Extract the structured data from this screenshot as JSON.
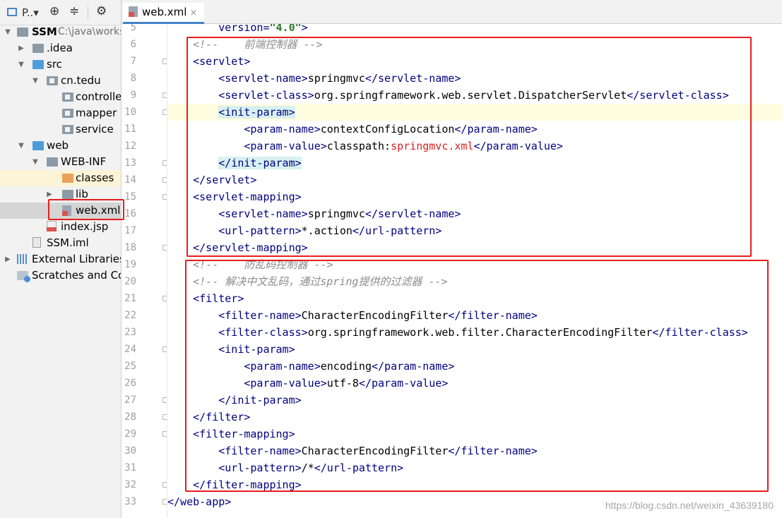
{
  "panel_toolbar": {
    "project_label": "P..▾"
  },
  "tree": [
    {
      "name": "SSM",
      "path": "C:\\java\\works"
    },
    {
      "name": ".idea"
    },
    {
      "name": "src"
    },
    {
      "name": "cn.tedu"
    },
    {
      "name": "controller"
    },
    {
      "name": "mapper"
    },
    {
      "name": "service"
    },
    {
      "name": "web"
    },
    {
      "name": "WEB-INF"
    },
    {
      "name": "classes"
    },
    {
      "name": "lib"
    },
    {
      "name": "web.xml"
    },
    {
      "name": "index.jsp"
    },
    {
      "name": "SSM.iml"
    },
    {
      "name": "External Libraries"
    },
    {
      "name": "Scratches and Cons"
    }
  ],
  "editor": {
    "tab_label": "web.xml",
    "tab_close": "×",
    "line_numbers": [
      "5",
      "6",
      "7",
      "8",
      "9",
      "10",
      "11",
      "12",
      "13",
      "14",
      "15",
      "16",
      "17",
      "18",
      "19",
      "20",
      "21",
      "22",
      "23",
      "24",
      "25",
      "26",
      "27",
      "28",
      "29",
      "30",
      "31",
      "32",
      "33"
    ],
    "lines": [
      [
        {
          "t": "        version=",
          "c": "tag"
        },
        {
          "t": "\"4.0\"",
          "c": "val"
        },
        {
          "t": ">",
          "c": "tag"
        }
      ],
      [
        {
          "t": "    <!--    前端控制器 -->",
          "c": "cmt"
        }
      ],
      [
        {
          "t": "    <",
          "c": "tag"
        },
        {
          "t": "servlet",
          "c": "tag"
        },
        {
          "t": ">",
          "c": "tag"
        }
      ],
      [
        {
          "t": "        <servlet-name>",
          "c": "tag"
        },
        {
          "t": "springmvc"
        },
        {
          "t": "</servlet-name>",
          "c": "tag"
        }
      ],
      [
        {
          "t": "        <servlet-class>",
          "c": "tag"
        },
        {
          "t": "org.springframework.web.servlet.DispatcherServlet"
        },
        {
          "t": "</servlet-class>",
          "c": "tag"
        }
      ],
      [
        {
          "t": "        "
        },
        {
          "t": "<init-param>",
          "c": "tag match"
        }
      ],
      [
        {
          "t": "            <param-name>",
          "c": "tag"
        },
        {
          "t": "contextConfigLocation"
        },
        {
          "t": "</param-name>",
          "c": "tag"
        }
      ],
      [
        {
          "t": "            <param-value>",
          "c": "tag"
        },
        {
          "t": "classpath:"
        },
        {
          "t": "springmvc.xml",
          "c": "red"
        },
        {
          "t": "</param-value>",
          "c": "tag"
        }
      ],
      [
        {
          "t": "        "
        },
        {
          "t": "</init-param>",
          "c": "tag match"
        }
      ],
      [
        {
          "t": "    </servlet>",
          "c": "tag"
        }
      ],
      [
        {
          "t": "    <servlet-mapping>",
          "c": "tag"
        }
      ],
      [
        {
          "t": "        <servlet-name>",
          "c": "tag"
        },
        {
          "t": "springmvc"
        },
        {
          "t": "</servlet-name>",
          "c": "tag"
        }
      ],
      [
        {
          "t": "        <url-pattern>",
          "c": "tag"
        },
        {
          "t": "*.action"
        },
        {
          "t": "</url-pattern>",
          "c": "tag"
        }
      ],
      [
        {
          "t": "    </servlet-mapping>",
          "c": "tag"
        }
      ],
      [
        {
          "t": "    <!--    防乱码控制器 -->",
          "c": "cmt"
        }
      ],
      [
        {
          "t": "    <!-- 解决中文乱码，通过spring提供的过滤器 -->",
          "c": "cmt"
        }
      ],
      [
        {
          "t": "    <filter>",
          "c": "tag"
        }
      ],
      [
        {
          "t": "        <filter-name>",
          "c": "tag"
        },
        {
          "t": "CharacterEncodingFilter"
        },
        {
          "t": "</filter-name>",
          "c": "tag"
        }
      ],
      [
        {
          "t": "        <filter-class>",
          "c": "tag"
        },
        {
          "t": "org.springframework.web.filter.CharacterEncodingFilter"
        },
        {
          "t": "</filter-class>",
          "c": "tag"
        }
      ],
      [
        {
          "t": "        <init-param>",
          "c": "tag"
        }
      ],
      [
        {
          "t": "            <param-name>",
          "c": "tag"
        },
        {
          "t": "encoding"
        },
        {
          "t": "</param-name>",
          "c": "tag"
        }
      ],
      [
        {
          "t": "            <param-value>",
          "c": "tag"
        },
        {
          "t": "utf-8"
        },
        {
          "t": "</param-value>",
          "c": "tag"
        }
      ],
      [
        {
          "t": "        </init-param>",
          "c": "tag"
        }
      ],
      [
        {
          "t": "    </filter>",
          "c": "tag"
        }
      ],
      [
        {
          "t": "    <filter-mapping>",
          "c": "tag"
        }
      ],
      [
        {
          "t": "        <filter-name>",
          "c": "tag"
        },
        {
          "t": "CharacterEncodingFilter"
        },
        {
          "t": "</filter-name>",
          "c": "tag"
        }
      ],
      [
        {
          "t": "        <url-pattern>",
          "c": "tag"
        },
        {
          "t": "/*"
        },
        {
          "t": "</url-pattern>",
          "c": "tag"
        }
      ],
      [
        {
          "t": "    </filter-mapping>",
          "c": "tag"
        }
      ],
      [
        {
          "t": "</web-app>",
          "c": "tag"
        }
      ]
    ]
  },
  "watermark": "https://blog.csdn.net/weixin_43639180",
  "colors": {
    "annotation_box": "#e81d1d",
    "tag": "#000080",
    "comment": "#8c8c8c"
  }
}
